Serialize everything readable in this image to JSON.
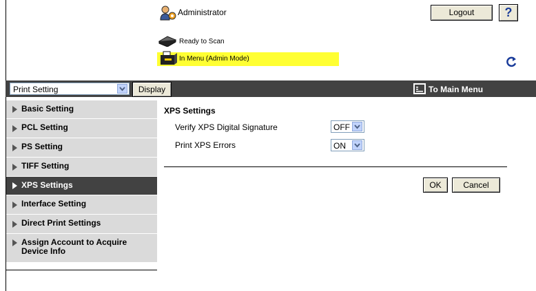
{
  "header": {
    "user": "Administrator",
    "logout_label": "Logout",
    "help_label": "?",
    "status_ready": "Ready to Scan",
    "status_menu": "In Menu (Admin Mode)"
  },
  "topbar": {
    "category": "Print Setting",
    "display_label": "Display",
    "to_main_label": "To Main Menu"
  },
  "sidebar": {
    "items": [
      {
        "label": "Basic Setting"
      },
      {
        "label": "PCL Setting"
      },
      {
        "label": "PS Setting"
      },
      {
        "label": "TIFF Setting"
      },
      {
        "label": "XPS Settings"
      },
      {
        "label": "Interface Setting"
      },
      {
        "label": "Direct Print Settings"
      },
      {
        "label": "Assign Account to Acquire Device Info"
      }
    ],
    "active_index": 4
  },
  "main": {
    "title": "XPS Settings",
    "rows": [
      {
        "label": "Verify XPS Digital Signature",
        "value": "OFF"
      },
      {
        "label": "Print XPS Errors",
        "value": "ON"
      }
    ],
    "ok_label": "OK",
    "cancel_label": "Cancel"
  },
  "colors": {
    "dark_bar": "#424242",
    "sidebar_bg": "#dadada",
    "status_highlight": "#ffff33"
  }
}
